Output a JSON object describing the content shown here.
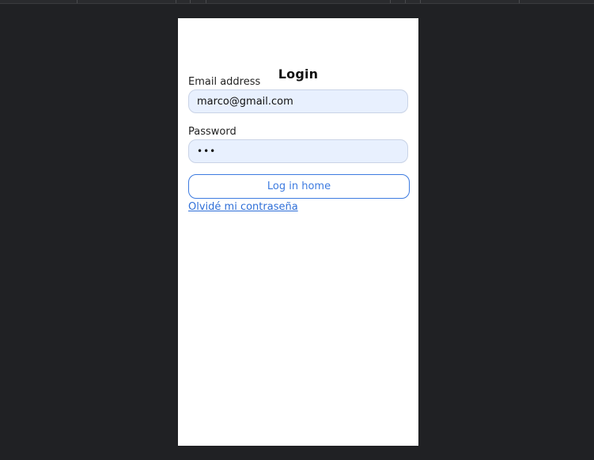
{
  "login": {
    "title": "Login",
    "email_label": "Email address",
    "email_value": "marco@gmail.com",
    "password_label": "Password",
    "password_value": "•••",
    "submit_label": "Log in home",
    "forgot_link": "Olvidé mi contraseña"
  },
  "colors": {
    "background": "#202124",
    "card": "#ffffff",
    "input_bg": "#e8f0fe",
    "accent": "#3d7be0"
  }
}
